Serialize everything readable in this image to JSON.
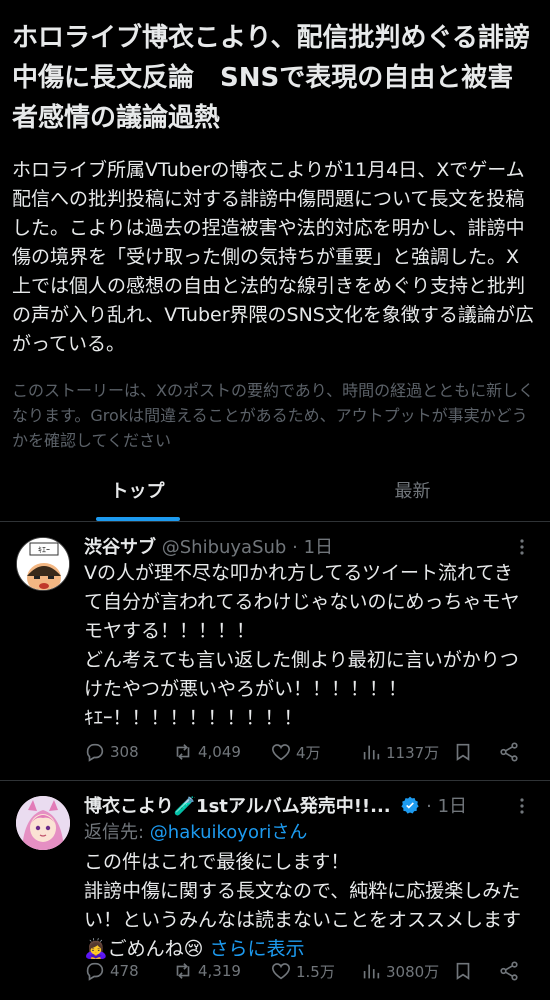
{
  "story": {
    "title": "ホロライブ博衣こより、配信批判めぐる誹謗中傷に長文反論　SNSで表現の自由と被害者感情の議論過熱",
    "summary": "ホロライブ所属VTuberの博衣こよりが11月4日、Xでゲーム配信への批判投稿に対する誹謗中傷問題について長文を投稿した。こよりは過去の捏造被害や法的対応を明かし、誹謗中傷の境界を「受け取った側の気持ちが重要」と強調した。X上では個人の感想の自由と法的な線引きをめぐり支持と批判の声が入り乱れ、VTuber界隈のSNS文化を象徴する議論が広がっている。",
    "disclaimer": "このストーリーは、Xのポストの要約であり、時間の経過とともに新しくなります。Grokは間違えることがあるため、アウトプットが事実かどうかを確認してください"
  },
  "tabs": [
    {
      "label": "トップ",
      "active": true
    },
    {
      "label": "最新",
      "active": false
    }
  ],
  "tweets": [
    {
      "name": "渋谷サブ",
      "handle": "@ShibuyaSub",
      "dot": "·",
      "time": "1日",
      "avatar_text": "ｷｴｰ",
      "lines": [
        "Vの人が理不尽な叩かれ方してるツイート流れてきて自分が言われてるわけじゃないのにめっちゃモヤモヤする！！！！！",
        "どん考えても言い返した側より最初に言いがかりつけたやつが悪いやろがい！！！！！！",
        "ｷｴｰ！！！！！！！！！！"
      ],
      "stats": {
        "replies": "308",
        "retweets": "4,049",
        "likes": "4万",
        "views": "1137万"
      }
    },
    {
      "name": "博衣こより🧪1stアルバム発売中!!...",
      "handle": "",
      "dot": "·",
      "time": "1日",
      "reply_prefix": "返信先: ",
      "reply_mention": "@hakuikoyoriさん",
      "lines": [
        "この件はこれで最後にします！",
        "誹謗中傷に関する長文なので、純粋に応援楽しみたい！というみんなは読まないことをオススメします🙇‍♀️ごめんね😢 "
      ],
      "show_more": "さらに表示",
      "stats": {
        "replies": "478",
        "retweets": "4,319",
        "likes": "1.5万",
        "views": "3080万"
      }
    }
  ],
  "colors": {
    "accent": "#1d9bf0",
    "muted": "#71767b",
    "text": "#e7e9ea",
    "divider": "#2f3336"
  },
  "icons": [
    "reply-icon",
    "retweet-icon",
    "like-icon",
    "views-icon",
    "bookmark-icon",
    "share-icon",
    "more-icon",
    "verified-icon"
  ]
}
